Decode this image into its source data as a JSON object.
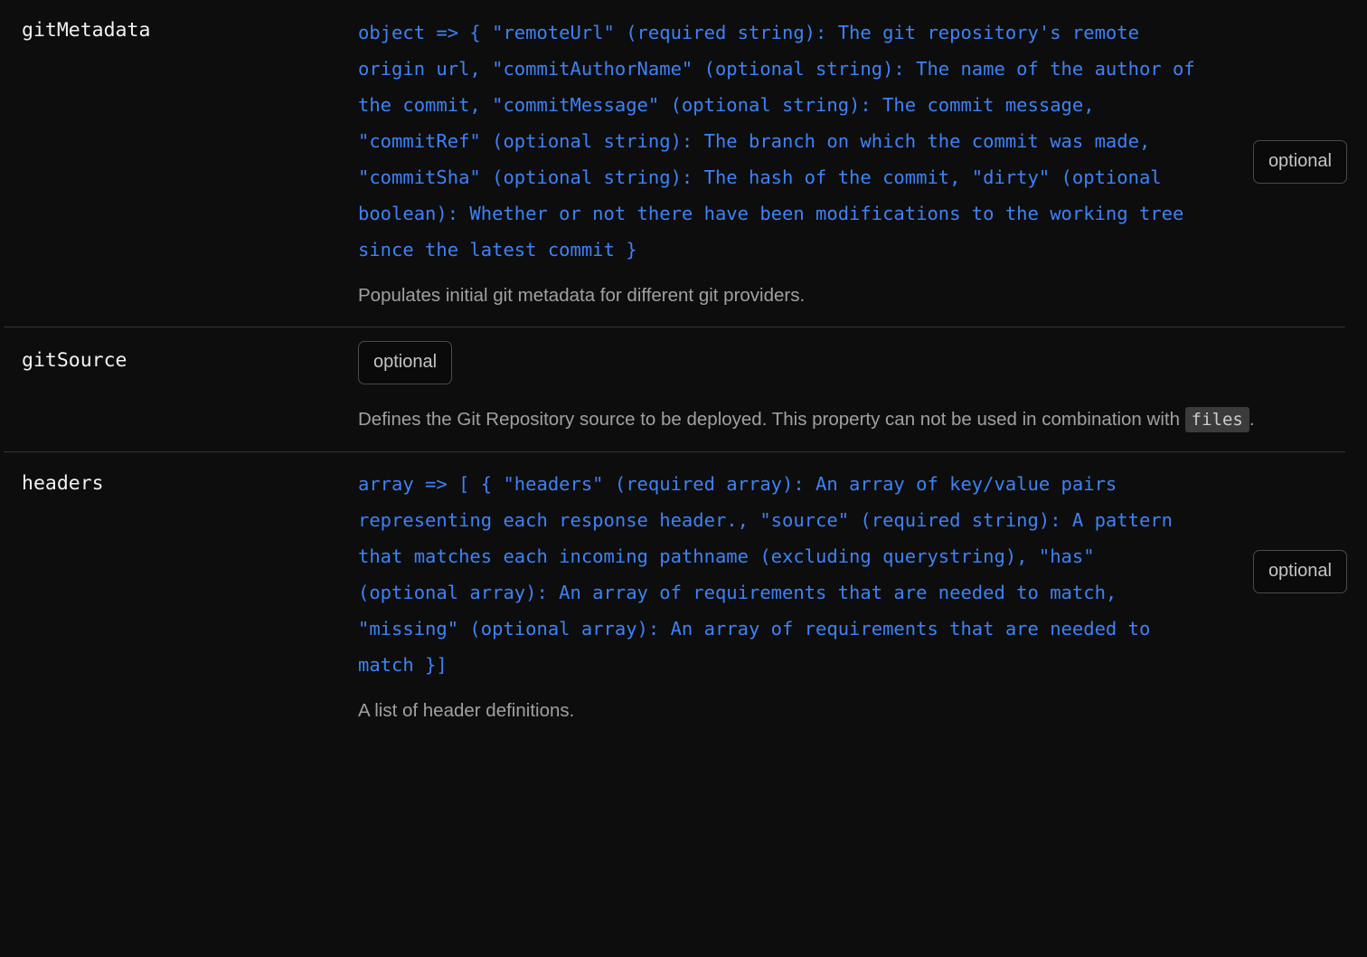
{
  "theme": {
    "background": "#0d0d0d",
    "code_blue": "#3e82f7",
    "description_grey": "#a0a0a0",
    "name_white": "#f2f2f2",
    "divider": "#333333",
    "inline_code_bg": "#3b3b3b",
    "badge_border": "#4a4a4a"
  },
  "properties": [
    {
      "name": "gitMetadata",
      "badge": "optional",
      "signature": "object => { \"remoteUrl\" (required string): The git repository's remote origin url, \"commitAuthorName\" (optional string): The name of the author of the commit, \"commitMessage\" (optional string): The commit message, \"commitRef\" (optional string): The branch on which the commit was made, \"commitSha\" (optional string): The hash of the commit, \"dirty\" (optional boolean): Whether or not there have been modifications to the working tree since the latest commit }",
      "description": "Populates initial git metadata for different git providers."
    },
    {
      "name": "gitSource",
      "badge": "optional",
      "signature": "",
      "description_part1": "Defines the Git Repository source to be deployed. This property can not be used in combination with ",
      "description_code": "files",
      "description_part2": "."
    },
    {
      "name": "headers",
      "badge": "optional",
      "signature": "array => [ { \"headers\" (required array): An array of key/value pairs representing each response header., \"source\" (required string): A pattern that matches each incoming pathname (excluding querystring), \"has\" (optional array): An array of requirements that are needed to match, \"missing\" (optional array): An array of requirements that are needed to match }]",
      "description": "A list of header definitions."
    }
  ]
}
